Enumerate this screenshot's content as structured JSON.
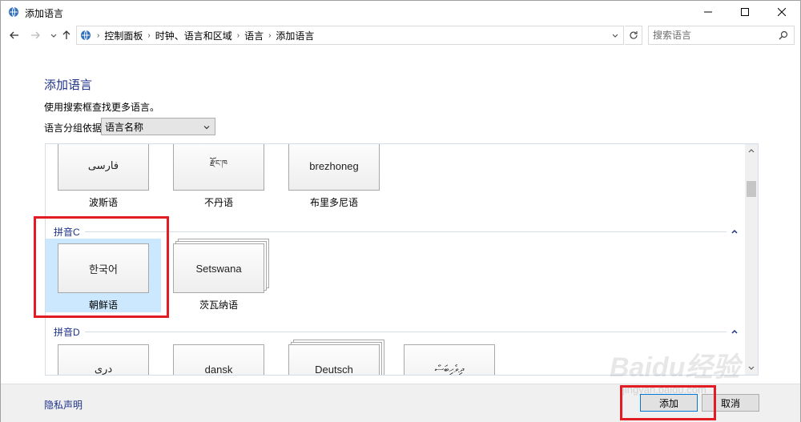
{
  "window": {
    "title": "添加语言"
  },
  "address": {
    "breadcrumbs": [
      "控制面板",
      "时钟、语言和区域",
      "语言",
      "添加语言"
    ]
  },
  "search": {
    "placeholder": "搜索语言"
  },
  "content": {
    "title": "添加语言",
    "description": "使用搜索框查找更多语言。",
    "group_by_label": "语言分组依据:",
    "group_by_value": "语言名称"
  },
  "tiles_row_b": [
    {
      "card": "فارسی",
      "name": "波斯语"
    },
    {
      "card": "རྫོང་ཁ",
      "name": "不丹语"
    },
    {
      "card": "brezhoneg",
      "name": "布里多尼语"
    }
  ],
  "section_c": {
    "label": "拼音C"
  },
  "tiles_row_c": [
    {
      "card": "한국어",
      "name": "朝鲜语"
    },
    {
      "card": "Setswana",
      "name": "茨瓦纳语"
    }
  ],
  "section_d": {
    "label": "拼音D"
  },
  "tiles_row_d": [
    {
      "card": "دری"
    },
    {
      "card": "dansk"
    },
    {
      "card": "Deutsch"
    },
    {
      "card": "ދިވެހިބަސް"
    }
  ],
  "footer": {
    "privacy": "隐私声明",
    "add_label": "添加",
    "cancel_label": "取消"
  },
  "watermark": {
    "brand": "Baidu经验",
    "url": "jingyan.baidu.com"
  },
  "colors": {
    "link": "#1e3287",
    "highlight": "#e31b23",
    "selected_tile": "#cce8ff"
  }
}
